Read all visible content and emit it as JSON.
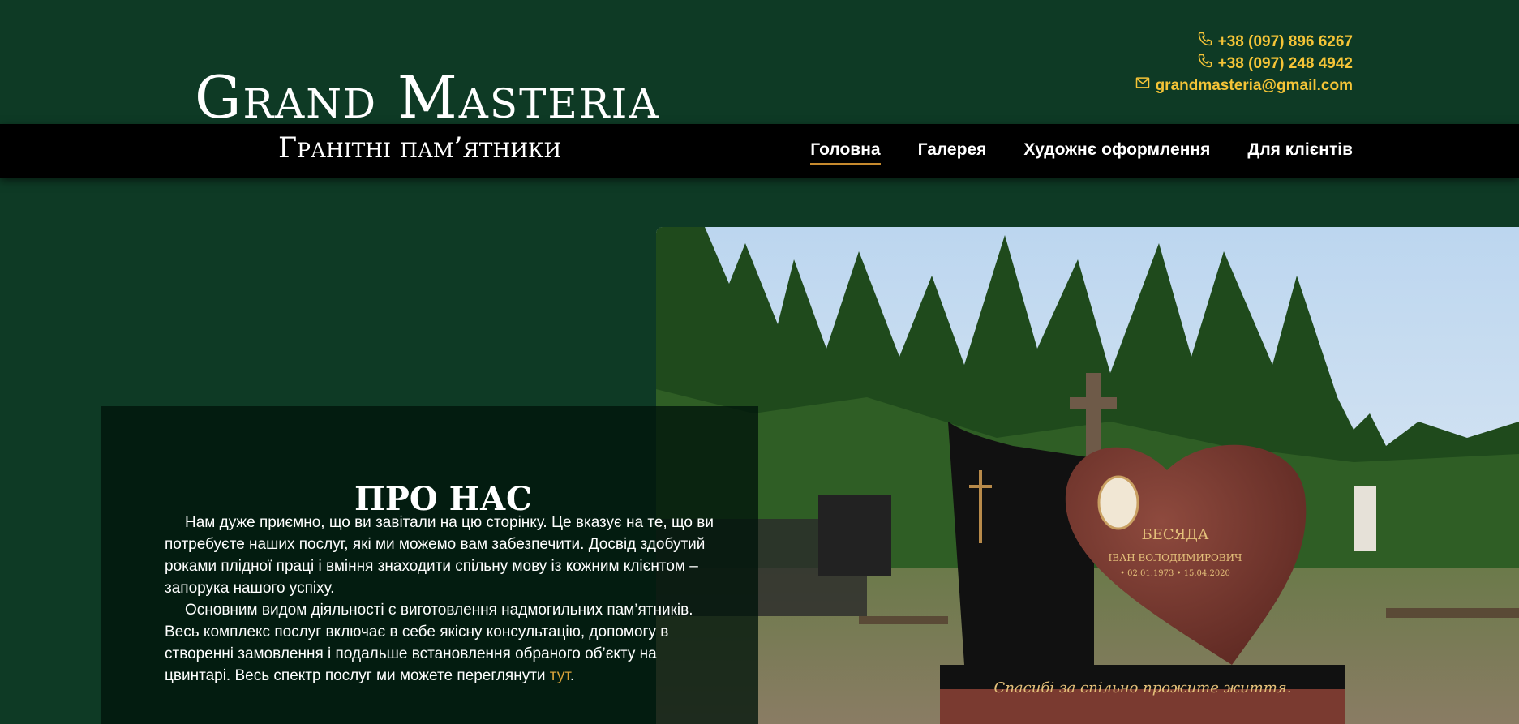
{
  "header": {
    "logo": "Grand Masteria",
    "subtitle": "Гранітні пам’ятники",
    "contacts": {
      "phone1": "+38 (097) 896 6267",
      "phone2": "+38 (097) 248 4942",
      "email": "grandmasteria@gmail.com"
    }
  },
  "nav": {
    "items": [
      "Головна",
      "Галерея",
      "Художнє оформлення",
      "Для клієнтів"
    ],
    "active": "Головна"
  },
  "about": {
    "title": "ПРО НАС",
    "paragraph1": "Нам дуже приємно, що ви завітали на цю сторінку. Це вказує на те, що ви потребуєте наших послуг, які ми можемо вам забезпечити. Досвід здобутий роками плідної праці і вміння знаходити спільну мову із кожним клієнтом – запорука нашого успіху.",
    "paragraph2": "Основним видом діяльності є виготовлення надмогильних пам’ятників. Весь комплекс послуг включає в себе якісну консультацію, допомогу в створенні замовлення і подальше встановлення обраного об’єкту на цвинтарі. Весь спектр послуг ми можете переглянути ",
    "link": "тут",
    "after_link": "."
  },
  "photo": {
    "surname": "БЕСЯДА",
    "name": "ІВАН ВОЛОДИМИРОВИЧ",
    "dates": "• 02.01.1973   • 15.04.2020",
    "inscription": "Спасибі за спільно прожите життя."
  },
  "colors": {
    "background": "#0e3a25",
    "accent": "#f5c437",
    "navbar": "#000000"
  }
}
